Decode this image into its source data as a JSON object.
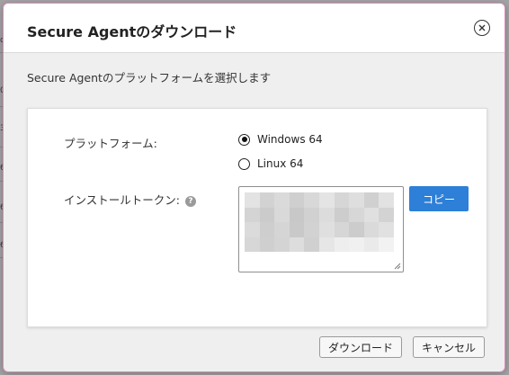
{
  "background": {
    "edge_text": [
      "d",
      "0-",
      "31",
      "6",
      "6",
      "6",
      "6"
    ]
  },
  "dialog": {
    "title": "Secure Agentのダウンロード",
    "subtitle": "Secure Agentのプラットフォームを選択します",
    "close_icon": "close-circle-icon"
  },
  "form": {
    "platform_label": "プラットフォーム:",
    "platform_options": [
      {
        "label": "Windows 64",
        "selected": true
      },
      {
        "label": "Linux 64",
        "selected": false
      }
    ],
    "token_label": "インストールトークン:",
    "help_icon": "?",
    "copy_label": "コピー"
  },
  "footer": {
    "download_label": "ダウンロード",
    "cancel_label": "キャンセル"
  },
  "colors": {
    "accent": "#2d7fd8",
    "dialog_border": "#d98cc0"
  }
}
